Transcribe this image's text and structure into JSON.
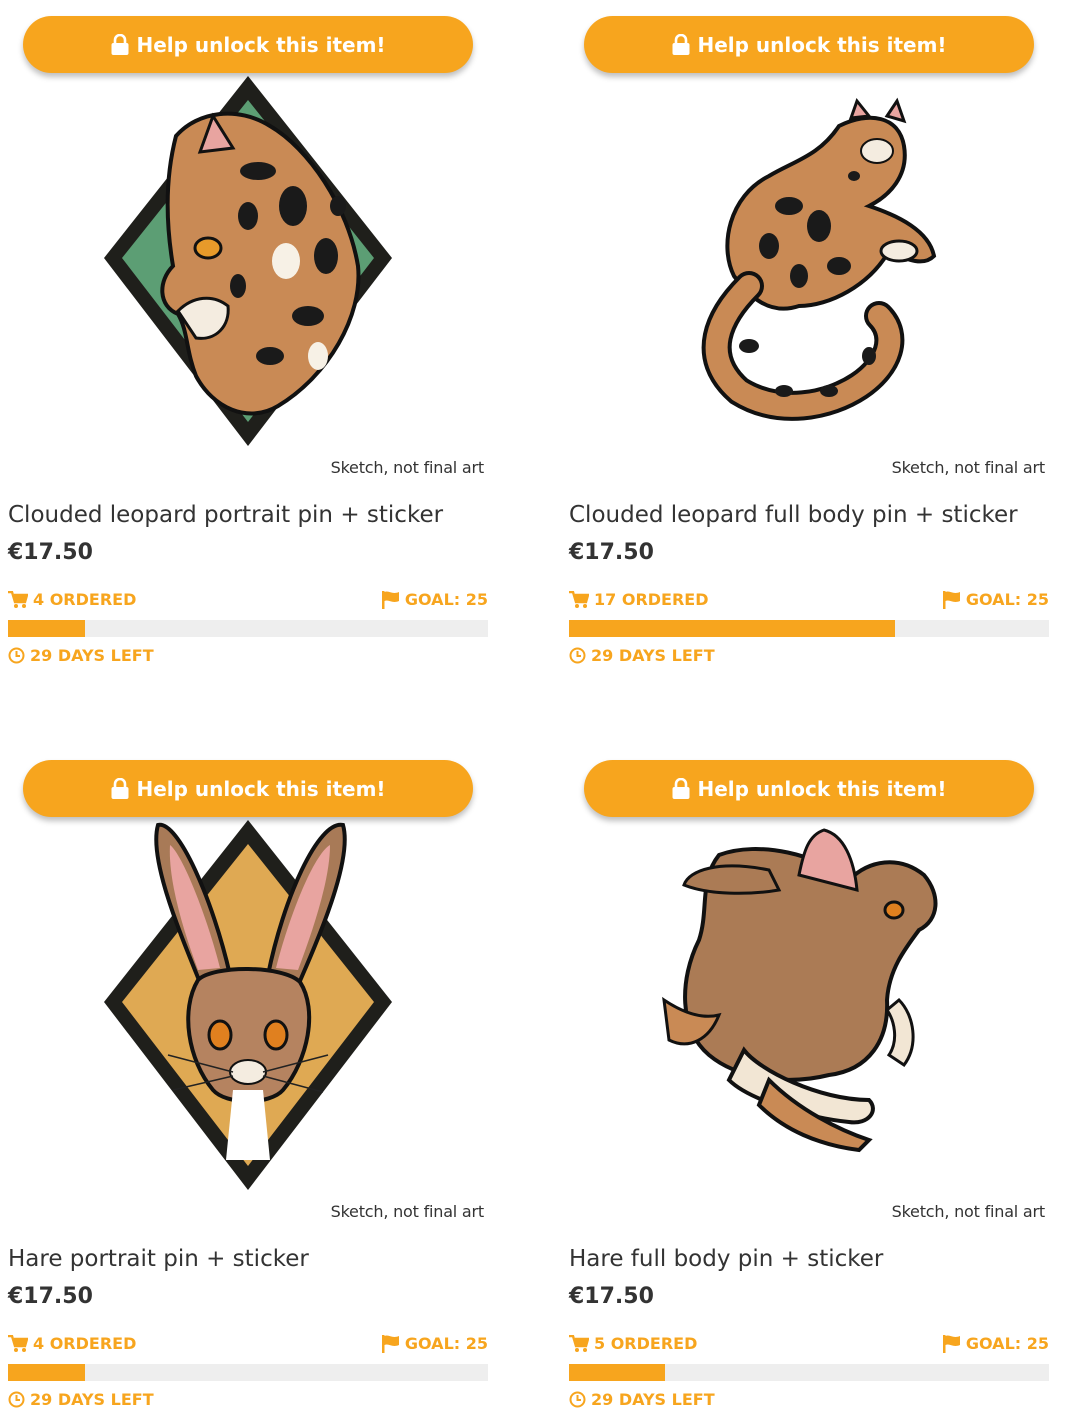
{
  "colors": {
    "accent": "#f7a51e",
    "track": "#eeeeee",
    "text": "#333333"
  },
  "products": [
    {
      "button_label": "Help unlock this item!",
      "art_icon": "clouded-leopard-portrait-art",
      "sketch_note": "Sketch, not final art",
      "title": "Clouded leopard portrait pin + sticker",
      "price": "€17.50",
      "ordered_text": "4 ORDERED",
      "goal_text": "GOAL: 25",
      "ordered": 4,
      "goal": 25,
      "days_left_text": "29 DAYS LEFT"
    },
    {
      "button_label": "Help unlock this item!",
      "art_icon": "clouded-leopard-full-body-art",
      "sketch_note": "Sketch, not final art",
      "title": "Clouded leopard full body pin + sticker",
      "price": "€17.50",
      "ordered_text": "17 ORDERED",
      "goal_text": "GOAL: 25",
      "ordered": 17,
      "goal": 25,
      "days_left_text": "29 DAYS LEFT"
    },
    {
      "button_label": "Help unlock this item!",
      "art_icon": "hare-portrait-art",
      "sketch_note": "Sketch, not final art",
      "title": "Hare portrait pin + sticker",
      "price": "€17.50",
      "ordered_text": "4 ORDERED",
      "goal_text": "GOAL: 25",
      "ordered": 4,
      "goal": 25,
      "days_left_text": "29 DAYS LEFT"
    },
    {
      "button_label": "Help unlock this item!",
      "art_icon": "hare-full-body-art",
      "sketch_note": "Sketch, not final art",
      "title": "Hare full body pin + sticker",
      "price": "€17.50",
      "ordered_text": "5 ORDERED",
      "goal_text": "GOAL: 25",
      "ordered": 5,
      "goal": 25,
      "days_left_text": "29 DAYS LEFT"
    }
  ]
}
